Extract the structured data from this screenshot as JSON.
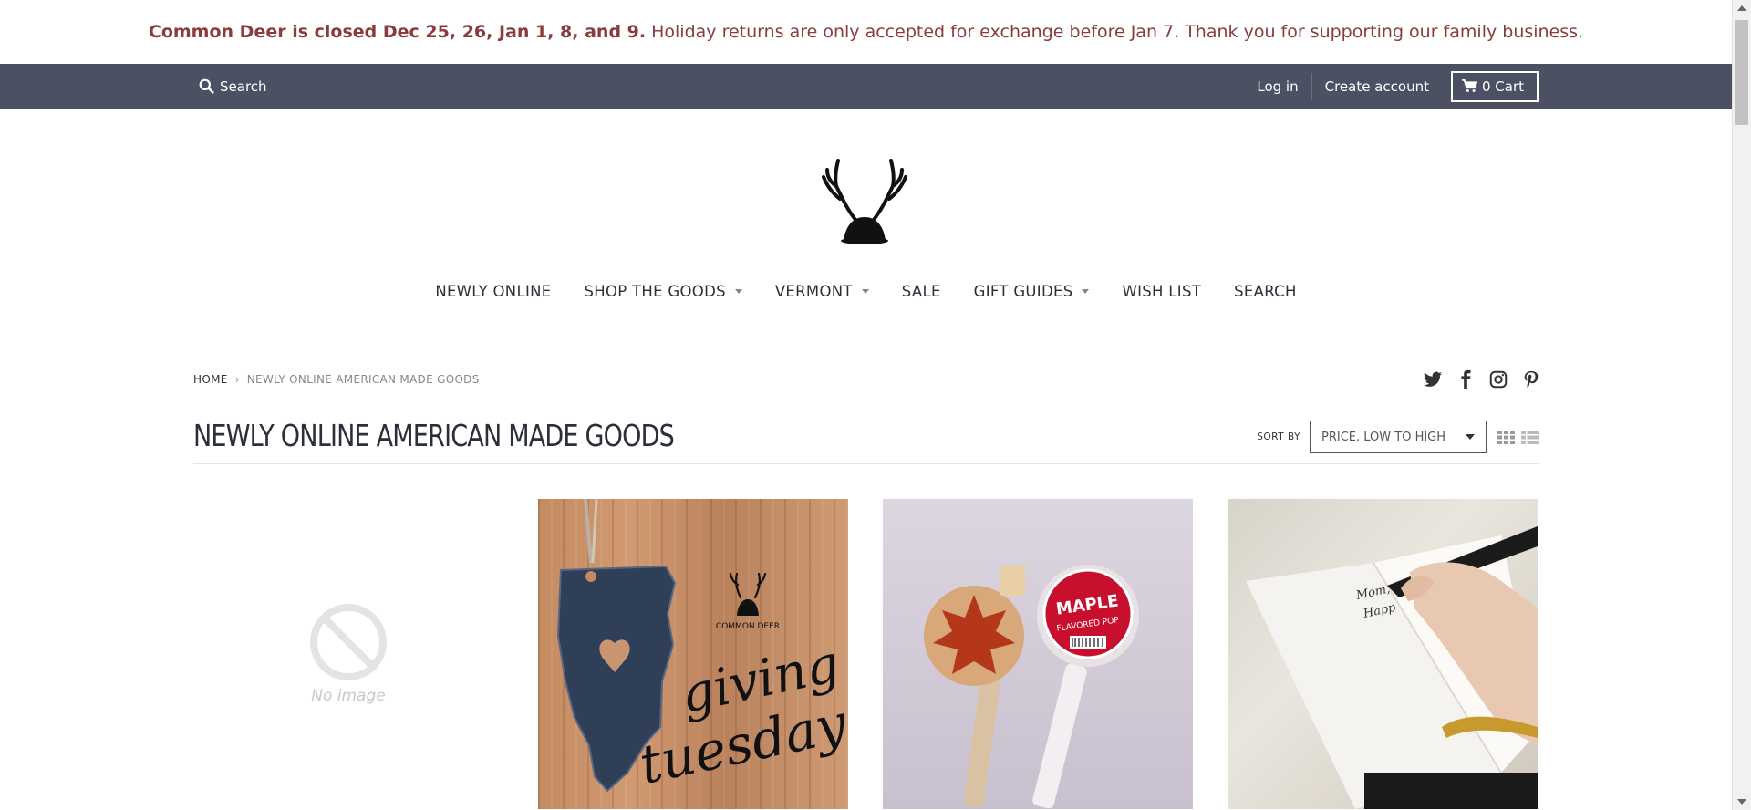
{
  "announcement": {
    "bold": "Common Deer is closed Dec 25, 26, Jan 1, 8, and 9.",
    "text": "Holiday returns are only accepted for exchange before Jan 7. Thank you for supporting our family business."
  },
  "topbar": {
    "search_label": "Search",
    "login_label": "Log in",
    "create_account_label": "Create account",
    "cart_label": "0 Cart"
  },
  "nav": {
    "items": [
      {
        "label": "NEWLY ONLINE"
      },
      {
        "label": "SHOP THE GOODS"
      },
      {
        "label": "VERMONT"
      },
      {
        "label": "SALE"
      },
      {
        "label": "GIFT GUIDES"
      },
      {
        "label": "WISH LIST"
      },
      {
        "label": "SEARCH"
      }
    ]
  },
  "breadcrumb": {
    "home": "HOME",
    "separator": "›",
    "current": "NEWLY ONLINE AMERICAN MADE GOODS"
  },
  "collection": {
    "title": "NEWLY ONLINE AMERICAN MADE GOODS",
    "sort_label": "SORT BY",
    "sort_value": "PRICE, LOW TO HIGH"
  },
  "products": {
    "no_image_text": "No image",
    "giving_word1": "giving",
    "giving_word2": "tuesday",
    "brand_small": "COMMON DEER",
    "maple_word": "MAPLE",
    "maple_sub": "FLAVORED POP",
    "note_text1": "Mom,",
    "note_text2": "Happ"
  },
  "colors": {
    "announce_text": "#8a3b3b",
    "topbar_bg": "#4b5162",
    "nav_text": "#2b2f3a"
  }
}
